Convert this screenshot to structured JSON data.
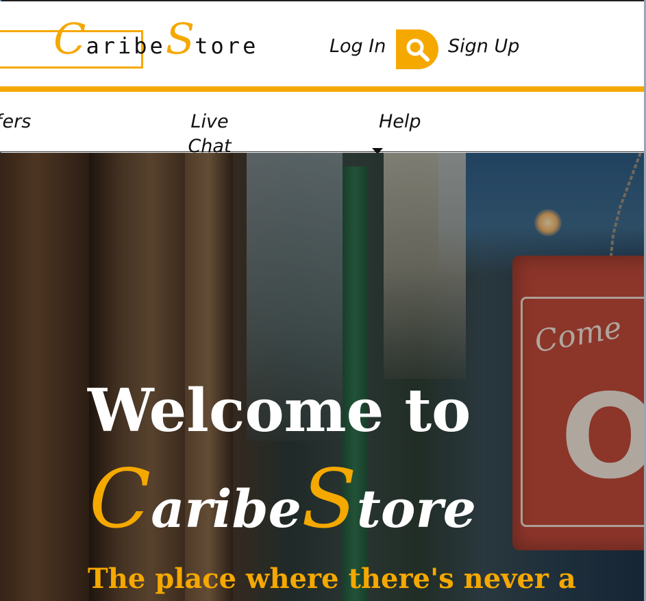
{
  "header": {
    "logo": {
      "cap1": "C",
      "part1": "aribe",
      "cap2": "S",
      "part2": "tore"
    },
    "login_label": "Log In",
    "search_icon": "search-icon",
    "signup_label": "Sign Up"
  },
  "nav": {
    "items": [
      {
        "label": "ffers"
      },
      {
        "label": "Live Chat"
      },
      {
        "label": "Help"
      }
    ]
  },
  "hero": {
    "welcome": "Welcome to",
    "brand": {
      "cap1": "C",
      "part1": "aribe",
      "cap2": "S",
      "part2": "tore"
    },
    "tagline": "The place where there's never a",
    "sign_text_1": "Come",
    "sign_text_2": "O"
  },
  "colors": {
    "accent": "#f5a800",
    "text": "#111111",
    "hero_text": "#ffffff"
  }
}
